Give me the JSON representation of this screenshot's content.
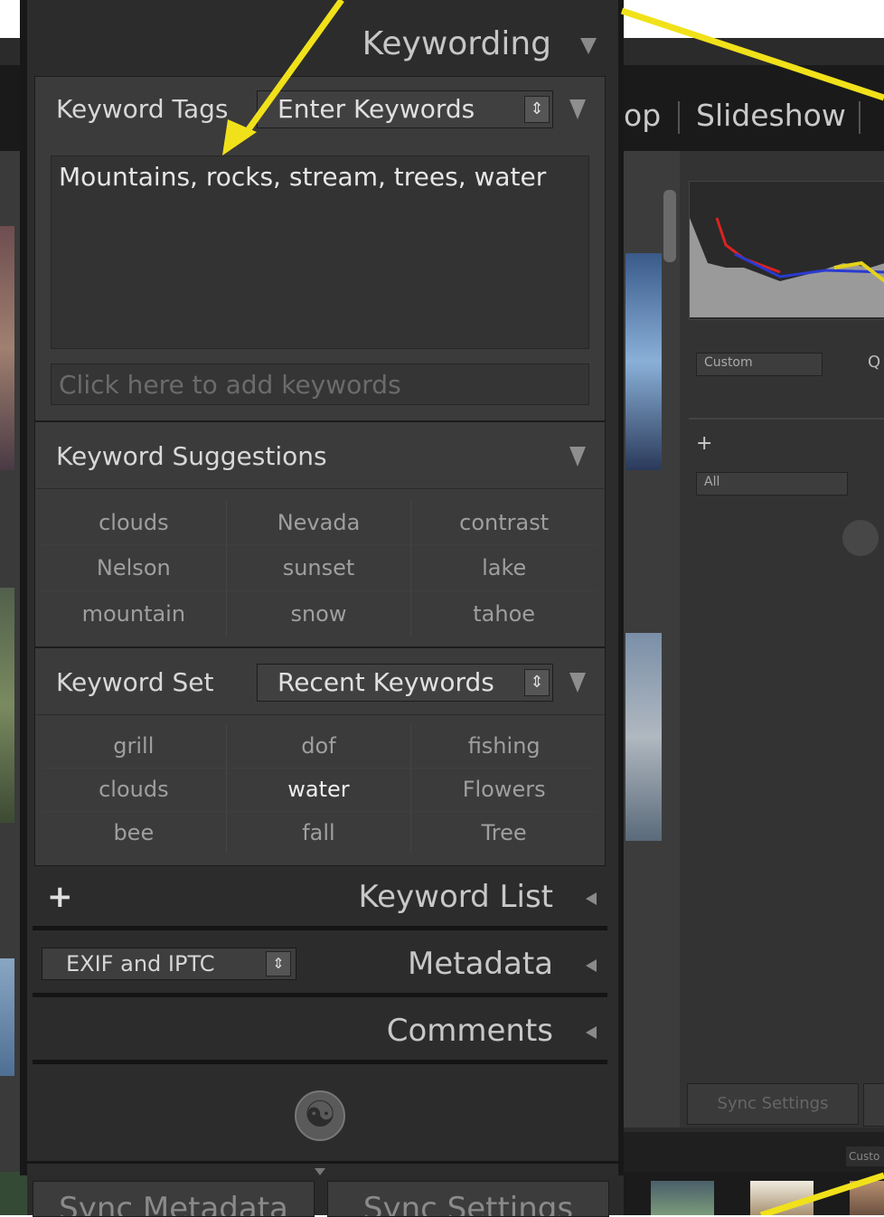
{
  "module_bar": {
    "partial_left": "op",
    "slideshow": "Slideshow"
  },
  "keywording": {
    "title": "Keywording",
    "keyword_tags": {
      "label": "Keyword Tags",
      "mode": "Enter Keywords",
      "value": "Mountains, rocks, stream, trees, water",
      "add_placeholder": "Click here to add keywords"
    },
    "suggestions": {
      "label": "Keyword Suggestions",
      "items": [
        "clouds",
        "Nevada",
        "contrast",
        "Nelson",
        "sunset",
        "lake",
        "mountain",
        "snow",
        "tahoe"
      ]
    },
    "keyword_set": {
      "label": "Keyword Set",
      "selected": "Recent Keywords",
      "items": [
        "grill",
        "dof",
        "fishing",
        "clouds",
        "water",
        "Flowers",
        "bee",
        "fall",
        "Tree"
      ],
      "active_item": "water"
    }
  },
  "keyword_list": {
    "title": "Keyword List",
    "add": "+"
  },
  "metadata": {
    "title": "Metadata",
    "preset": "EXIF and IPTC"
  },
  "comments": {
    "title": "Comments"
  },
  "buttons": {
    "sync_metadata": "Sync Metadata",
    "sync_settings": "Sync Settings"
  },
  "right_panel": {
    "preset": "Custom",
    "filter": "All",
    "sync": "Sync Settings",
    "plus": "+",
    "q": "Q",
    "film_custom": "Custo"
  },
  "colors": {
    "arrow": "#f1e11a",
    "panel": "#2c2c2c",
    "section": "#3b3b3b"
  }
}
